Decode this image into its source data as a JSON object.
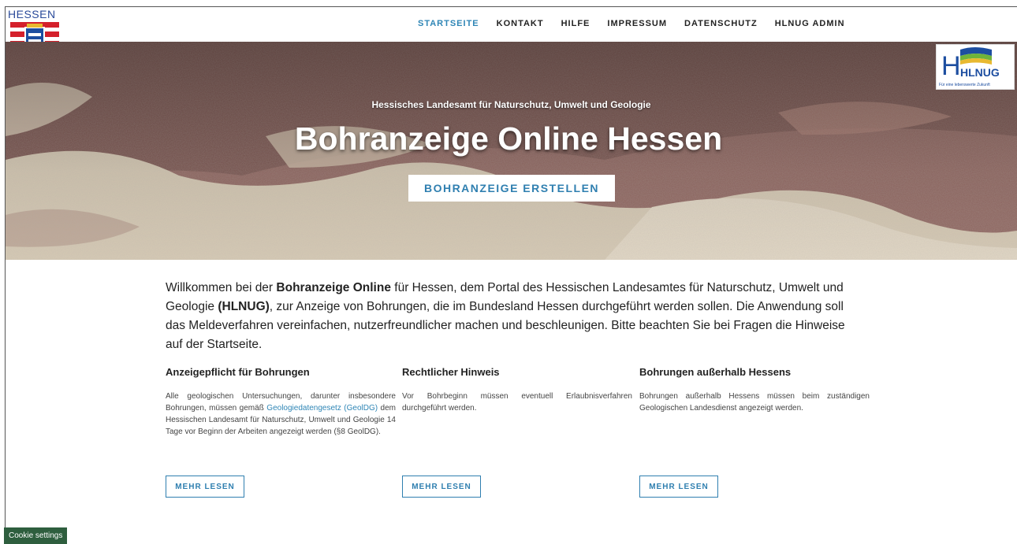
{
  "brand": {
    "state_name": "HESSEN"
  },
  "nav": {
    "items": [
      {
        "label": "STARTSEITE",
        "active": true
      },
      {
        "label": "KONTAKT"
      },
      {
        "label": "HILFE"
      },
      {
        "label": "IMPRESSUM"
      },
      {
        "label": "DATENSCHUTZ"
      },
      {
        "label": "HLNUG ADMIN"
      }
    ]
  },
  "hero": {
    "logo_text": "HLNUG",
    "logo_tagline": "Für eine lebenswerte Zukunft",
    "subtitle": "Hessisches Landesamt für Naturschutz, Umwelt und Geologie",
    "title": "Bohranzeige Online Hessen",
    "cta_label": "BOHRANZEIGE ERSTELLEN"
  },
  "intro": {
    "part1": "Willkommen bei der ",
    "bold1": "Bohranzeige Online",
    "part2": " für Hessen, dem Portal des Hessischen Landesamtes für Naturschutz, Umwelt und Geologie ",
    "bold2": "(HLNUG)",
    "part3": ", zur Anzeige von Bohrungen, die im Bundesland Hessen durchgeführt werden sollen. Die Anwendung soll das Meldeverfahren vereinfachen, nutzerfreundlicher machen und beschleunigen. Bitte beachten Sie bei Fragen die Hinweise auf der Startseite."
  },
  "columns": [
    {
      "title": "Anzeigepflicht für Bohrungen",
      "text_before": "Alle geologischen Untersuchungen, darunter insbesondere Bohrungen, müssen gemäß ",
      "link": "Geologiedatengesetz (GeolDG)",
      "text_after": " dem Hessischen Landesamt für Naturschutz, Umwelt und Geologie 14 Tage vor Beginn der Arbeiten angezeigt werden (§8 GeolDG).",
      "button": "MEHR LESEN"
    },
    {
      "title": "Rechtlicher Hinweis",
      "text_before": "Vor Bohrbeginn müssen eventuell Erlaubnisverfahren durchgeführt werden.",
      "button": "MEHR LESEN"
    },
    {
      "title": "Bohrungen außerhalb Hessens",
      "text_before": "Bohrungen außerhalb Hessens müssen beim zuständigen Geologischen Landesdienst angezeigt werden.",
      "button": "MEHR LESEN"
    }
  ],
  "cookie": {
    "label": "Cookie settings"
  },
  "colors": {
    "accent": "#2f86b6",
    "hero_stone_red": "#9a6a64",
    "hero_stone_light": "#d8cdb8",
    "cookie_bg": "#2e5e3e",
    "hessen_red": "#d4202b"
  }
}
